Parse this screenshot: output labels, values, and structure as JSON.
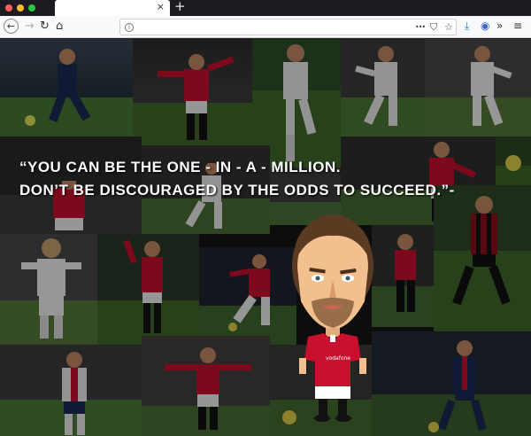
{
  "browser": {
    "tab_title": "",
    "tab_close_glyph": "×",
    "new_tab_glyph": "+",
    "url": "",
    "nav": {
      "back": "←",
      "forward": "→",
      "reload": "↻",
      "home": "⌂"
    },
    "url_icons": {
      "more": "•••",
      "pocket": "⛉",
      "bookmark": "☆"
    },
    "toolbar_icons": {
      "download": "⤓",
      "account": "◉",
      "overflow": "»",
      "menu": "≡"
    },
    "traffic_colors": [
      "#ff5f57",
      "#febc2e",
      "#28c840"
    ]
  },
  "page": {
    "quote_line1": "“You can be the one - in - a - million.",
    "quote_line2": "Don’t be discouraged by the odds to succeed.”-"
  },
  "colors": {
    "red_kit": "#c8102e",
    "white_kit": "#eeeeee",
    "navy_kit": "#1b2a55",
    "pitch": "#3f6b2a",
    "crowd": "#3a3a3a"
  }
}
